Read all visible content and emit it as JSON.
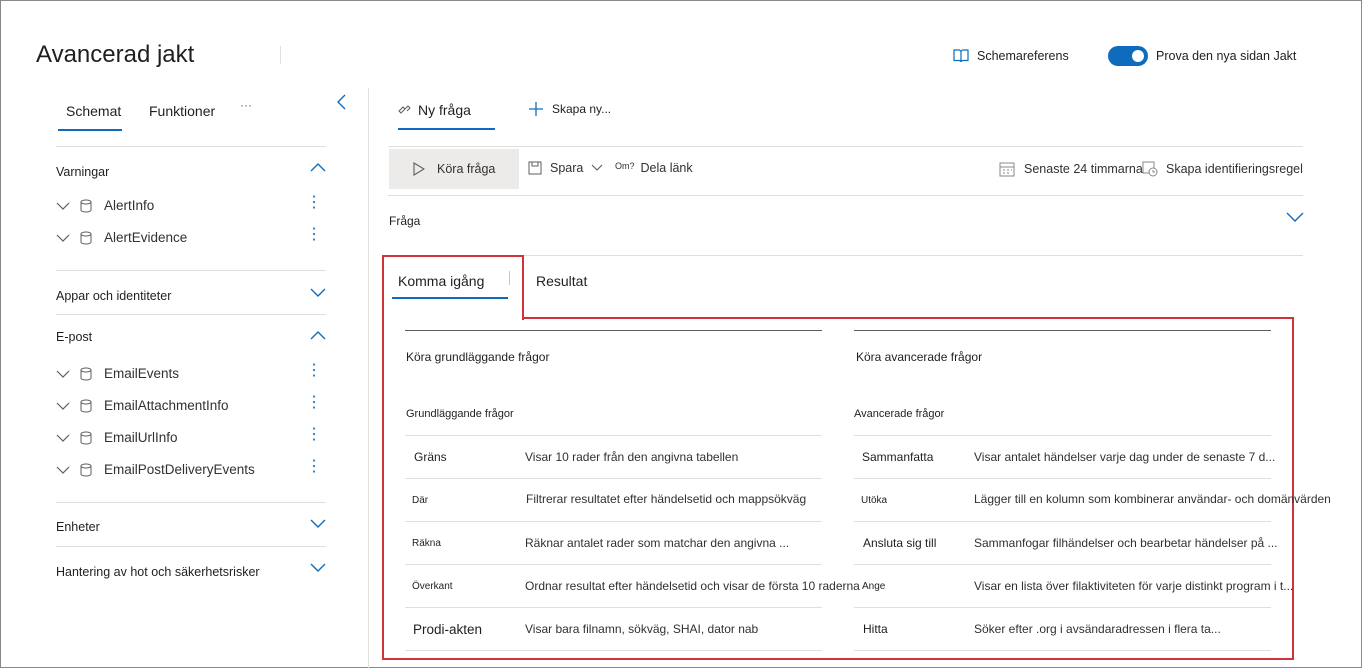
{
  "header": {
    "title": "Avancerad jakt",
    "schema_reference": "Schemareferens",
    "toggle_label": "Prova den nya sidan Jakt"
  },
  "sidebar": {
    "tabs": [
      "Schemat",
      "Funktioner"
    ],
    "more": "···",
    "sections": {
      "alerts": {
        "title": "Varningar",
        "items": [
          "AlertInfo",
          "AlertEvidence"
        ]
      },
      "apps": {
        "title": "Appar och identiteter"
      },
      "email": {
        "title": "E-post",
        "items": [
          "EmailEvents",
          "EmailAttachmentInfo",
          "EmailUrlInfo",
          "EmailPostDeliveryEvents"
        ]
      },
      "devices": {
        "title": "Enheter"
      },
      "threat": {
        "title": "Hantering av hot och säkerhetsrisker"
      }
    }
  },
  "query_tabs": {
    "new_query": "Ny fråga",
    "create_new": "Skapa ny..."
  },
  "commands": {
    "run": "Köra fråga",
    "save": "Spara",
    "share_prefix": "Om?",
    "share": "Dela länk",
    "time_range": "Senaste 24 timmarna",
    "create_rule": "Skapa identifieringsregel"
  },
  "query_section": "Fråga",
  "result_tabs": {
    "get_started": "Komma igång",
    "results": "Resultat"
  },
  "basic": {
    "heading": "Köra grundläggande frågor",
    "subheading": "Grundläggande frågor",
    "rows": [
      {
        "name": "Gräns",
        "desc": "Visar 10 rader från den angivna tabellen"
      },
      {
        "name": "Där",
        "desc": "Filtrerar resultatet efter händelsetid och mappsökväg"
      },
      {
        "name": "Räkna",
        "desc": "Räknar antalet rader som matchar den angivna ..."
      },
      {
        "name": "Överkant",
        "desc": "Ordnar resultat efter händelsetid och visar de första 10 raderna"
      },
      {
        "name": "Prodi-akten",
        "desc": "Visar bara filnamn, sökväg, SHAI, dator nab"
      }
    ]
  },
  "advanced": {
    "heading": "Köra avancerade frågor",
    "subheading": "Avancerade frågor",
    "rows": [
      {
        "name": "Sammanfatta",
        "desc": "Visar antalet händelser varje dag under de senaste 7 d..."
      },
      {
        "name": "Utöka",
        "desc": "Lägger till en kolumn som kombinerar användar- och domänvärden"
      },
      {
        "name": "Ansluta sig till",
        "desc": "Sammanfogar filhändelser och bearbetar händelser på ..."
      },
      {
        "name": "Ange",
        "desc": "Visar en lista över filaktiviteten för varje distinkt program i t..."
      },
      {
        "name": "Hitta",
        "desc": "Söker efter .org i avsändaradressen i flera ta..."
      }
    ]
  },
  "colors": {
    "accent": "#0f6cbd",
    "highlight": "#d13438"
  }
}
